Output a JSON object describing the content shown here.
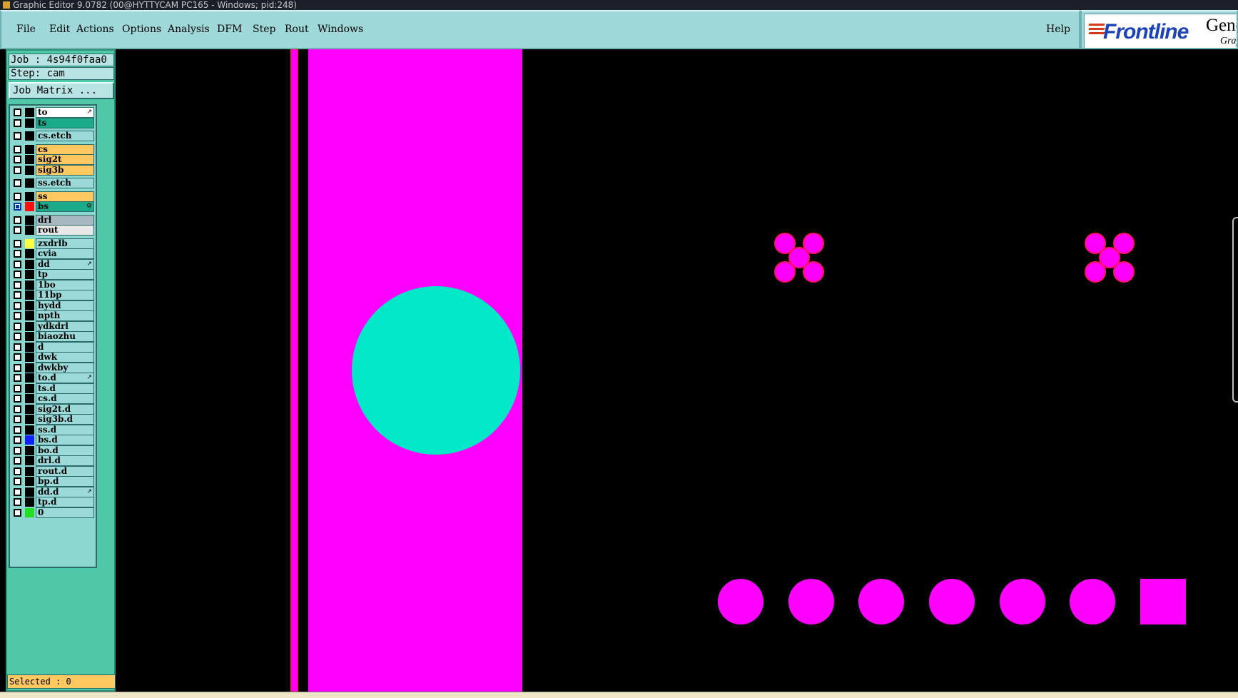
{
  "window": {
    "title": "Graphic Editor 9.0782 (00@HYTTYCAM PC165 - Windows; pid:248)"
  },
  "menu": [
    "File",
    "Edit",
    "Actions",
    "Options",
    "Analysis",
    "DFM",
    "Step",
    "Rout",
    "Windows"
  ],
  "help_label": "Help",
  "logo": {
    "brand": "Frontline",
    "product": "Gene",
    "subtitle": "Grap"
  },
  "job": {
    "job_label": "Job : 4s94f0faa0",
    "step_label": "Step: cam",
    "matrix_button": "Job Matrix ..."
  },
  "layers": [
    {
      "name": "to",
      "bg": "#ffffff",
      "color": "#000000",
      "flag": "↗"
    },
    {
      "name": "ts",
      "bg": "#1aaa8a",
      "color": "#000000"
    },
    {
      "name": "cs.etch",
      "bg": "#9cdada",
      "color": "#000000",
      "gap": true
    },
    {
      "name": "cs",
      "bg": "#ffc860",
      "color": "#000000",
      "gap": true
    },
    {
      "name": "sig2t",
      "bg": "#ffc860",
      "color": "#000000"
    },
    {
      "name": "sig3b",
      "bg": "#ffc860",
      "color": "#000000"
    },
    {
      "name": "ss.etch",
      "bg": "#9cdada",
      "color": "#000000",
      "gap": true
    },
    {
      "name": "ss",
      "bg": "#ffc860",
      "color": "#000000",
      "gap": true
    },
    {
      "name": "bs",
      "bg": "#1aaa8a",
      "color": "#ff1010",
      "active": true,
      "flag": "⚙"
    },
    {
      "name": "drl",
      "bg": "#a8b8c0",
      "color": "#000000",
      "gap": true
    },
    {
      "name": "rout",
      "bg": "#e8e8e8",
      "color": "#000000"
    },
    {
      "name": "zxdrlb",
      "bg": "#9cdada",
      "color": "#ffff40",
      "gap": true
    },
    {
      "name": "cvia",
      "bg": "#9cdada",
      "color": "#000000"
    },
    {
      "name": "dd",
      "bg": "#9cdada",
      "color": "#000000",
      "flag": "↗"
    },
    {
      "name": "tp",
      "bg": "#9cdada",
      "color": "#000000"
    },
    {
      "name": "1bo",
      "bg": "#9cdada",
      "color": "#000000"
    },
    {
      "name": "11bp",
      "bg": "#9cdada",
      "color": "#000000"
    },
    {
      "name": "hydd",
      "bg": "#9cdada",
      "color": "#000000"
    },
    {
      "name": "npth",
      "bg": "#9cdada",
      "color": "#000000"
    },
    {
      "name": "ydkdrl",
      "bg": "#9cdada",
      "color": "#000000"
    },
    {
      "name": "biaozhu",
      "bg": "#9cdada",
      "color": "#000000"
    },
    {
      "name": "d",
      "bg": "#9cdada",
      "color": "#000000"
    },
    {
      "name": "dwk",
      "bg": "#9cdada",
      "color": "#000000"
    },
    {
      "name": "dwkby",
      "bg": "#9cdada",
      "color": "#000000"
    },
    {
      "name": "to.d",
      "bg": "#9cdada",
      "color": "#000000",
      "flag": "↗"
    },
    {
      "name": "ts.d",
      "bg": "#9cdada",
      "color": "#000000"
    },
    {
      "name": "cs.d",
      "bg": "#9cdada",
      "color": "#000000"
    },
    {
      "name": "sig2t.d",
      "bg": "#9cdada",
      "color": "#000000"
    },
    {
      "name": "sig3b.d",
      "bg": "#9cdada",
      "color": "#000000"
    },
    {
      "name": "ss.d",
      "bg": "#9cdada",
      "color": "#000000"
    },
    {
      "name": "bs.d",
      "bg": "#9cdada",
      "color": "#1020ff"
    },
    {
      "name": "bo.d",
      "bg": "#9cdada",
      "color": "#000000"
    },
    {
      "name": "drl.d",
      "bg": "#9cdada",
      "color": "#000000"
    },
    {
      "name": "rout.d",
      "bg": "#9cdada",
      "color": "#000000"
    },
    {
      "name": "bp.d",
      "bg": "#9cdada",
      "color": "#000000"
    },
    {
      "name": "dd.d",
      "bg": "#9cdada",
      "color": "#000000",
      "flag": "↗"
    },
    {
      "name": "tp.d",
      "bg": "#9cdada",
      "color": "#000000"
    },
    {
      "name": "0",
      "bg": "#9cdada",
      "color": "#20e020"
    }
  ],
  "selected_label": "Selected : 0",
  "colors": {
    "feature": "#ff00ff",
    "outline": "#ff1060",
    "highlight": "#00e8c8",
    "canvas": "#000000"
  }
}
